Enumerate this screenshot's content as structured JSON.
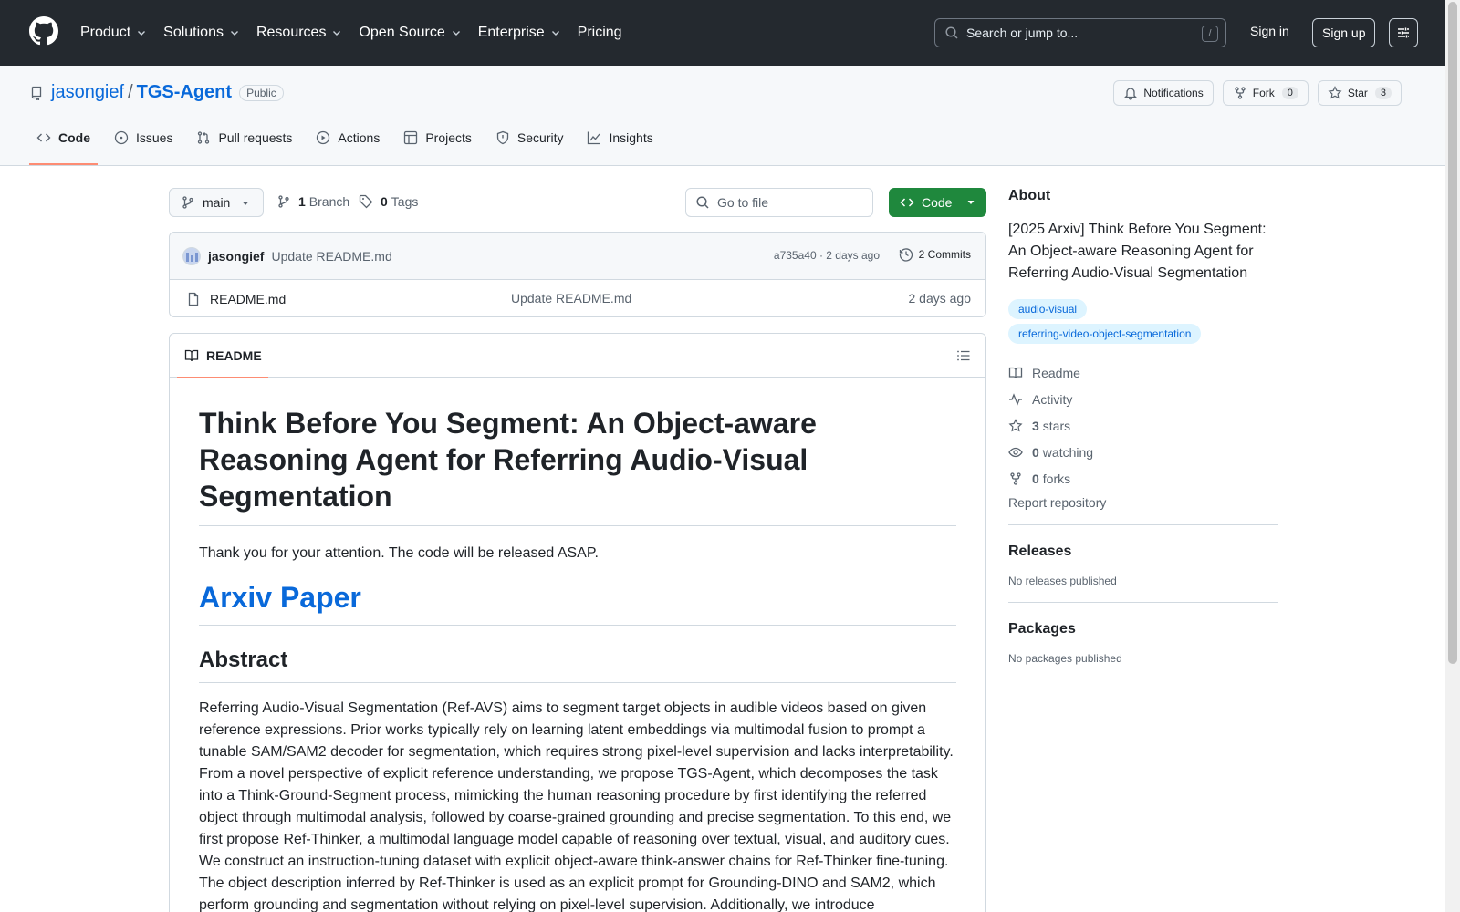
{
  "header": {
    "nav": [
      "Product",
      "Solutions",
      "Resources",
      "Open Source",
      "Enterprise",
      "Pricing"
    ],
    "search_placeholder": "Search or jump to...",
    "search_key": "/",
    "signin": "Sign in",
    "signup": "Sign up"
  },
  "repo": {
    "owner": "jasongief",
    "separator": "/",
    "name": "TGS-Agent",
    "visibility": "Public",
    "notifications": "Notifications",
    "fork_label": "Fork",
    "fork_count": "0",
    "star_label": "Star",
    "star_count": "3"
  },
  "tabs": [
    "Code",
    "Issues",
    "Pull requests",
    "Actions",
    "Projects",
    "Security",
    "Insights"
  ],
  "toolbar": {
    "branch": "main",
    "branch_count": "1",
    "branch_label": "Branch",
    "tag_count": "0",
    "tag_label": "Tags",
    "goto_placeholder": "Go to file",
    "code_button": "Code"
  },
  "commit": {
    "author": "jasongief",
    "message": "Update README.md",
    "meta": "a735a40 · 2 days ago",
    "commits": "2 Commits"
  },
  "files": [
    {
      "name": "README.md",
      "message": "Update README.md",
      "date": "2 days ago"
    }
  ],
  "readme": {
    "tab": "README",
    "title": "Think Before You Segment: An Object-aware Reasoning Agent for Referring Audio-Visual Segmentation",
    "lead": "Thank you for your attention. The code will be released ASAP.",
    "paper_link": "Arxiv Paper",
    "abstract_heading": "Abstract",
    "abstract": "Referring Audio-Visual Segmentation (Ref-AVS) aims to segment target objects in audible videos based on given reference expressions. Prior works typically rely on learning latent embeddings via multimodal fusion to prompt a tunable SAM/SAM2 decoder for segmentation, which requires strong pixel-level supervision and lacks interpretability. From a novel perspective of explicit reference understanding, we propose TGS-Agent, which decomposes the task into a Think-Ground-Segment process, mimicking the human reasoning procedure by first identifying the referred object through multimodal analysis, followed by coarse-grained grounding and precise segmentation. To this end, we first propose Ref-Thinker, a multimodal language model capable of reasoning over textual, visual, and auditory cues. We construct an instruction-tuning dataset with explicit object-aware think-answer chains for Ref-Thinker fine-tuning. The object description inferred by Ref-Thinker is used as an explicit prompt for Grounding-DINO and SAM2, which perform grounding and segmentation without relying on pixel-level supervision. Additionally, we introduce"
  },
  "sidebar": {
    "about": "About",
    "description": "[2025 Arxiv] Think Before You Segment: An Object-aware Reasoning Agent for Referring Audio-Visual Segmentation",
    "topics": [
      "audio-visual",
      "referring-video-object-segmentation"
    ],
    "readme": "Readme",
    "activity": "Activity",
    "stars_count": "3",
    "stars_label": "stars",
    "watching_count": "0",
    "watching_label": "watching",
    "forks_count": "0",
    "forks_label": "forks",
    "report": "Report repository",
    "releases": "Releases",
    "no_releases": "No releases published",
    "packages": "Packages",
    "no_packages": "No packages published"
  },
  "colors": {
    "header_bg": "#24292f",
    "link": "#0969da",
    "primary_green": "#1f883d",
    "tab_underline": "#fd8c73"
  }
}
